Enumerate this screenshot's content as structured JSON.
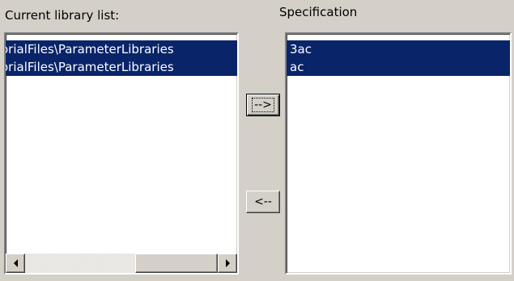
{
  "labels": {
    "current_library_list": "Current library list:",
    "specification": "Specification"
  },
  "current_library_list": {
    "items": [
      {
        "text": "orialFiles\\ParameterLibraries",
        "selected": true
      },
      {
        "text": "orialFiles\\ParameterLibraries",
        "selected": true
      }
    ],
    "scrollbar": {
      "left_icon": "arrow-left-icon",
      "right_icon": "arrow-right-icon"
    }
  },
  "specification_list": {
    "items": [
      {
        "text": "3ac",
        "selected": true
      },
      {
        "text": "ac",
        "selected": true
      }
    ]
  },
  "buttons": {
    "add_label": "-->",
    "remove_label": "<--"
  },
  "colors": {
    "window_bg": "#d4d0c8",
    "selection_bg": "#0a246a",
    "selection_text": "#ffffff"
  }
}
